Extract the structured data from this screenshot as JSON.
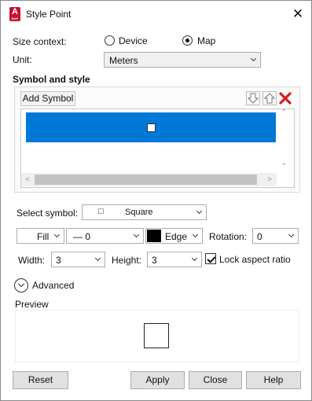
{
  "window": {
    "title": "Style Point",
    "app_icon_letter": "A",
    "app_icon_sub": "MAP",
    "close_glyph": "✕"
  },
  "size_context": {
    "label": "Size context:",
    "options": [
      {
        "label": "Device",
        "selected": false
      },
      {
        "label": "Map",
        "selected": true
      }
    ]
  },
  "unit": {
    "label": "Unit:",
    "value": "Meters"
  },
  "symbol_and_style": {
    "heading": "Symbol and style",
    "add_symbol_label": "Add Symbol",
    "move_down_icon": "arrow-down-outline-icon",
    "move_up_icon": "arrow-up-outline-icon",
    "delete_icon": "red-x-icon",
    "selected_row_color": "#0078d7",
    "scroll_glyphs": {
      "up": "⌃",
      "down": "⌄",
      "left": "<",
      "right": ">"
    }
  },
  "select_symbol": {
    "label": "Select symbol:",
    "value": "Square",
    "glyph": "□"
  },
  "fill": {
    "label": "Fill",
    "color": "#ffffff"
  },
  "line_style": {
    "value": "— 0"
  },
  "edge": {
    "label": "Edge",
    "color": "#000000"
  },
  "rotation": {
    "label": "Rotation:",
    "value": "0"
  },
  "width": {
    "label": "Width:",
    "value": "3"
  },
  "height": {
    "label": "Height:",
    "value": "3"
  },
  "lock_aspect": {
    "label": "Lock aspect ratio",
    "checked": true
  },
  "advanced": {
    "label": "Advanced"
  },
  "preview": {
    "label": "Preview"
  },
  "buttons": {
    "reset": "Reset",
    "apply": "Apply",
    "close": "Close",
    "help": "Help"
  }
}
